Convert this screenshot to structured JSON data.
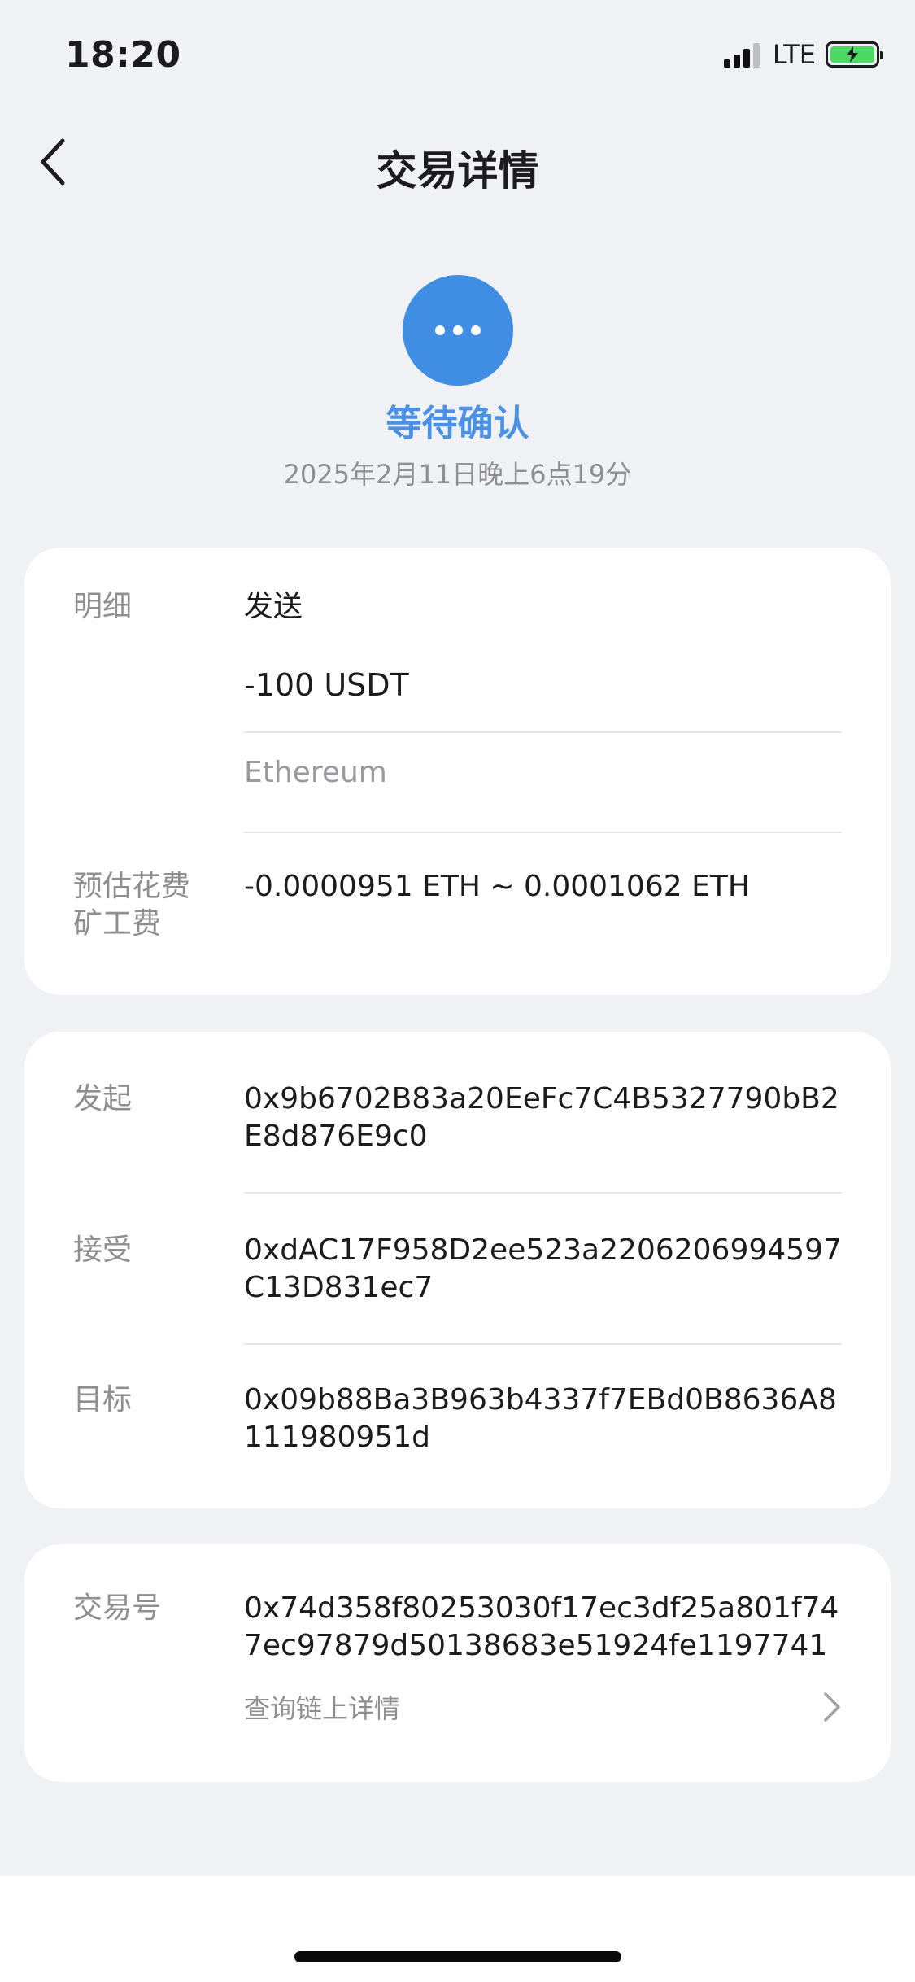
{
  "status_bar": {
    "time": "18:20",
    "network": "LTE"
  },
  "nav": {
    "title": "交易详情"
  },
  "transaction_status": {
    "label": "等待确认",
    "timestamp": "2025年2月11日晚上6点19分",
    "color": "#3f8ee4"
  },
  "details": {
    "label": "明细",
    "type": "发送",
    "amount": "-100 USDT",
    "network": "Ethereum",
    "fee_label_line1": "预估花费",
    "fee_label_line2": "矿工费",
    "fee_value": "-0.0000951 ETH ~ 0.0001062 ETH"
  },
  "addresses": {
    "from_label": "发起",
    "from_value": "0x9b6702B83a20EeFc7C4B5327790bB2E8d876E9c0",
    "to_label": "接受",
    "to_value": "0xdAC17F958D2ee523a2206206994597C13D831ec7",
    "target_label": "目标",
    "target_value": "0x09b88Ba3B963b4337f7EBd0B8636A8111980951d"
  },
  "tx": {
    "label": "交易号",
    "hash": "0x74d358f80253030f17ec3df25a801f747ec97879d50138683e51924fe1197741",
    "query_link": "查询链上详情"
  }
}
